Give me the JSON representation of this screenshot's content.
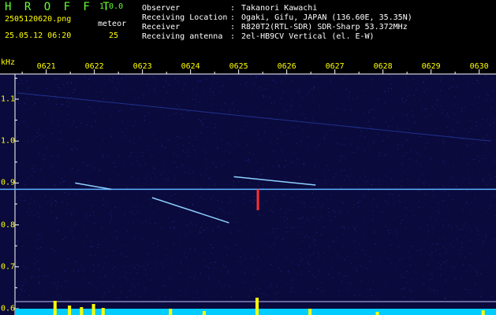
{
  "header": {
    "app_name": "H R O F F T",
    "app_version": "1.0.0",
    "filename": "2505120620.png",
    "datetime": "25.05.12 06:20",
    "meteor_label": "meteor",
    "meteor_count": "25",
    "info": [
      {
        "key": "Observer",
        "value": "Takanori Kawachi"
      },
      {
        "key": "Receiving Location",
        "value": "Ogaki, Gifu, JAPAN (136.60E, 35.35N)"
      },
      {
        "key": "Receiver",
        "value": "R820T2(RTL-SDR) SDR-Sharp 53.372MHz"
      },
      {
        "key": "Receiving antenna",
        "value": "2el-HB9CV Vertical (el. E-W)"
      }
    ],
    "colon": ":"
  },
  "chart_data": {
    "type": "heatmap",
    "title": "",
    "ylabel": "kHz",
    "x_tick_labels": [
      "0621",
      "0622",
      "0623",
      "0624",
      "0625",
      "0626",
      "0627",
      "0628",
      "0629",
      "0630"
    ],
    "y_tick_labels": [
      "1.1",
      "1.0",
      "0.9",
      "0.8",
      "0.7",
      "0.6"
    ],
    "y_ticks": [
      1.1,
      1.0,
      0.9,
      0.8,
      0.7,
      0.6
    ],
    "ylim": [
      0.585,
      1.16
    ],
    "xlim": [
      0,
      10
    ],
    "carrier_khz": 0.885,
    "meteor_echoes": [
      {
        "x_start": 2.85,
        "x_end": 4.45,
        "y_start": 0.865,
        "y_end": 0.805
      },
      {
        "x_start": 4.55,
        "x_end": 6.25,
        "y_start": 0.915,
        "y_end": 0.895
      },
      {
        "x_start": 5.05,
        "x_end": 5.05,
        "y_start": 0.885,
        "y_end": 0.835
      },
      {
        "x_start": 1.25,
        "x_end": 2.0,
        "y_start": 0.9,
        "y_end": 0.885
      }
    ],
    "colors": {
      "background": "#0a0a3c",
      "carrier": "#5fb0ff",
      "noise_floor": "#00ccff",
      "spike": "#ffff00",
      "echo": "#ff3030"
    }
  }
}
